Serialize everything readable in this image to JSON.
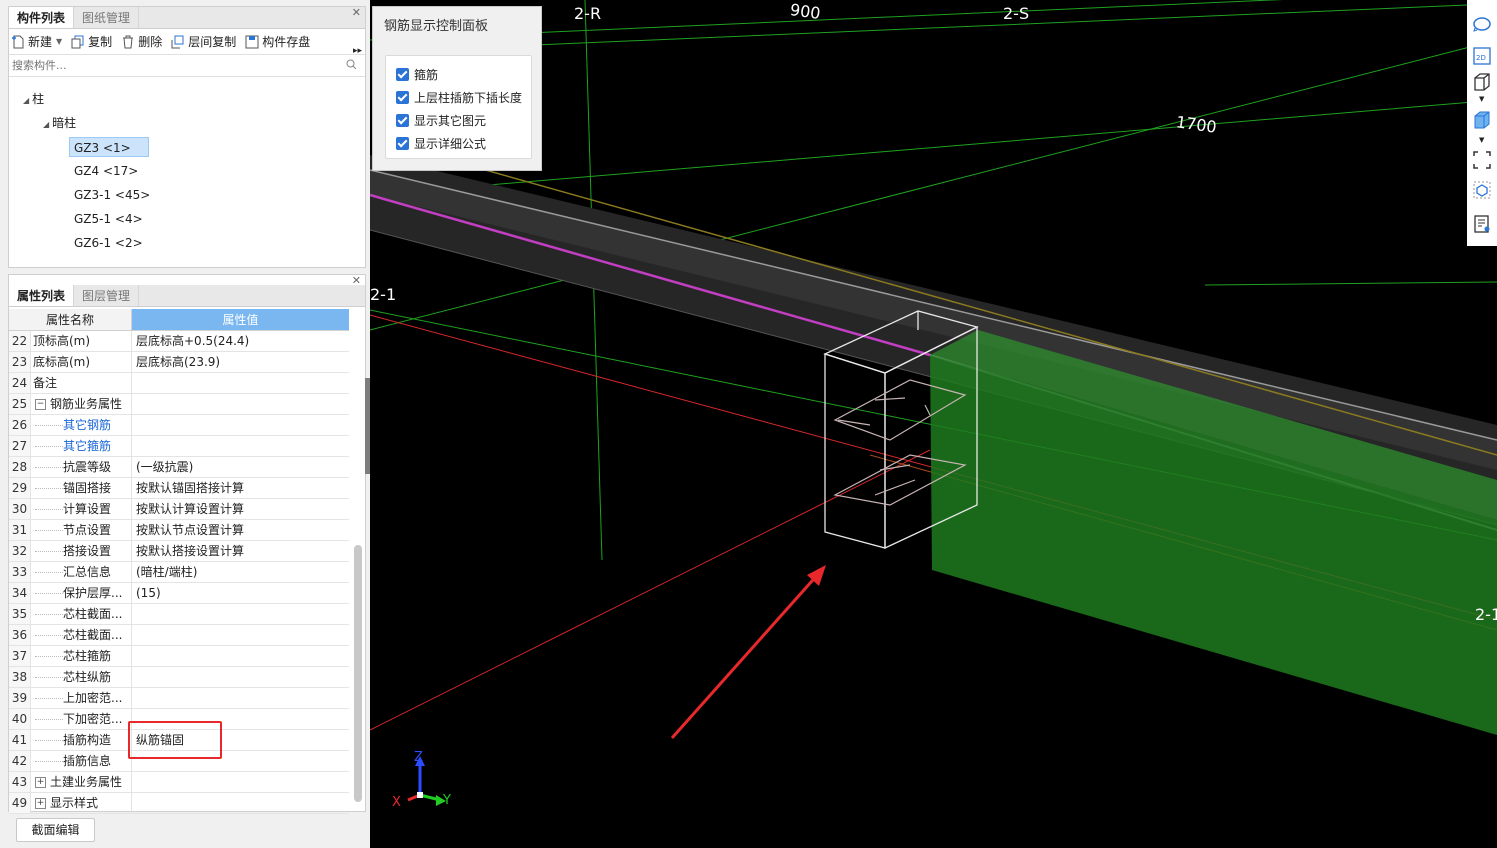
{
  "component_panel": {
    "tabs": [
      "构件列表",
      "图纸管理"
    ],
    "toolbar": [
      "新建",
      "复制",
      "删除",
      "层间复制",
      "构件存盘"
    ],
    "search_placeholder": "搜索构件...",
    "tree": {
      "root": "柱",
      "group": "暗柱",
      "items": [
        "GZ3 <1>",
        "GZ4 <17>",
        "GZ3-1 <45>",
        "GZ5-1 <4>",
        "GZ6-1 <2>"
      ]
    }
  },
  "property_panel": {
    "tabs": [
      "属性列表",
      "图层管理"
    ],
    "headers": [
      "属性名称",
      "属性值"
    ],
    "rows": [
      {
        "num": "22",
        "name": "顶标高(m)",
        "value": "层底标高+0.5(24.4)"
      },
      {
        "num": "23",
        "name": "底标高(m)",
        "value": "层底标高(23.9)"
      },
      {
        "num": "24",
        "name": "备注",
        "value": ""
      },
      {
        "num": "25",
        "name": "钢筋业务属性",
        "value": "",
        "expander": "−"
      },
      {
        "num": "26",
        "name": "其它钢筋",
        "value": "",
        "blue": true
      },
      {
        "num": "27",
        "name": "其它箍筋",
        "value": "",
        "blue": true
      },
      {
        "num": "28",
        "name": "抗震等级",
        "value": "(一级抗震)"
      },
      {
        "num": "29",
        "name": "锚固搭接",
        "value": "按默认锚固搭接计算"
      },
      {
        "num": "30",
        "name": "计算设置",
        "value": "按默认计算设置计算"
      },
      {
        "num": "31",
        "name": "节点设置",
        "value": "按默认节点设置计算"
      },
      {
        "num": "32",
        "name": "搭接设置",
        "value": "按默认搭接设置计算"
      },
      {
        "num": "33",
        "name": "汇总信息",
        "value": "(暗柱/端柱)"
      },
      {
        "num": "34",
        "name": "保护层厚...",
        "value": "(15)"
      },
      {
        "num": "35",
        "name": "芯柱截面...",
        "value": ""
      },
      {
        "num": "36",
        "name": "芯柱截面...",
        "value": ""
      },
      {
        "num": "37",
        "name": "芯柱箍筋",
        "value": ""
      },
      {
        "num": "38",
        "name": "芯柱纵筋",
        "value": ""
      },
      {
        "num": "39",
        "name": "上加密范...",
        "value": ""
      },
      {
        "num": "40",
        "name": "下加密范...",
        "value": ""
      },
      {
        "num": "41",
        "name": "插筋构造",
        "value": "纵筋锚固"
      },
      {
        "num": "42",
        "name": "插筋信息",
        "value": ""
      },
      {
        "num": "43",
        "name": "土建业务属性",
        "value": "",
        "expander": "+"
      },
      {
        "num": "49",
        "name": "显示样式",
        "value": "",
        "expander": "+"
      }
    ],
    "bottom_button": "截面编辑"
  },
  "control_panel": {
    "title": "钢筋显示控制面板",
    "options": [
      "箍筋",
      "上层柱插筋下插长度",
      "显示其它图元",
      "显示详细公式"
    ]
  },
  "viewport": {
    "labels": {
      "axis_2R": "2-R",
      "axis_2S": "2-S",
      "axis_2_1_left": "2-1",
      "axis_2_1_right": "2-1",
      "dim_900": "900",
      "dim_1700": "1700"
    },
    "axes": {
      "x": "X",
      "y": "Y",
      "z": "Z"
    }
  },
  "right_tools": [
    "orbit-icon",
    "2d-icon",
    "3d-box-icon",
    "solid-box-icon",
    "fullscreen-icon",
    "component-view-icon",
    "report-icon"
  ],
  "colors": {
    "highlight_red": "#e8282b",
    "accent_blue": "#2b74d6",
    "header_blue": "#7ab7f0",
    "green": "#1e7a1e"
  }
}
